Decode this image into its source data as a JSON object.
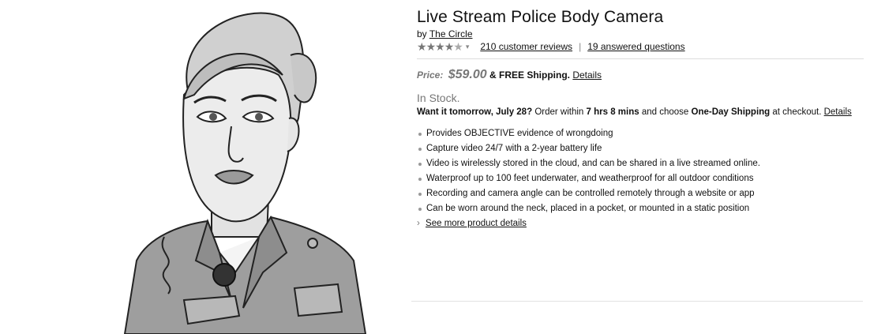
{
  "product": {
    "title": "Live Stream Police Body Camera",
    "by_prefix": "by",
    "brand": "The Circle",
    "rating_stars": 4.5,
    "reviews_link": "210 customer reviews",
    "separator": "|",
    "questions_link": "19 answered questions",
    "price_label": "Price:",
    "price_value": "$59.00",
    "shipping": "& FREE Shipping.",
    "price_details_link": "Details",
    "stock_status": "In Stock.",
    "delivery": {
      "want_it": "Want it tomorrow, July 28?",
      "order_within": "Order within",
      "time_left": "7 hrs 8 mins",
      "choose": "and choose",
      "shipping_option": "One-Day Shipping",
      "at_checkout": "at checkout.",
      "details_link": "Details"
    },
    "bullets": [
      "Provides OBJECTIVE evidence of wrongdoing",
      "Capture video 24/7 with a 2-year battery life",
      "Video is wirelessly stored in the cloud, and can be shared in a live streamed online.",
      "Waterproof up to 100 feet underwater, and weatherproof for all outdoor conditions",
      "Recording and camera angle can be controlled remotely through a website or app",
      "Can be worn around the neck, placed in a pocket, or mounted in a static position"
    ],
    "more_chevron": "›",
    "more_link": "See more product details"
  },
  "icons": {
    "star": "★",
    "caret": "▾"
  }
}
